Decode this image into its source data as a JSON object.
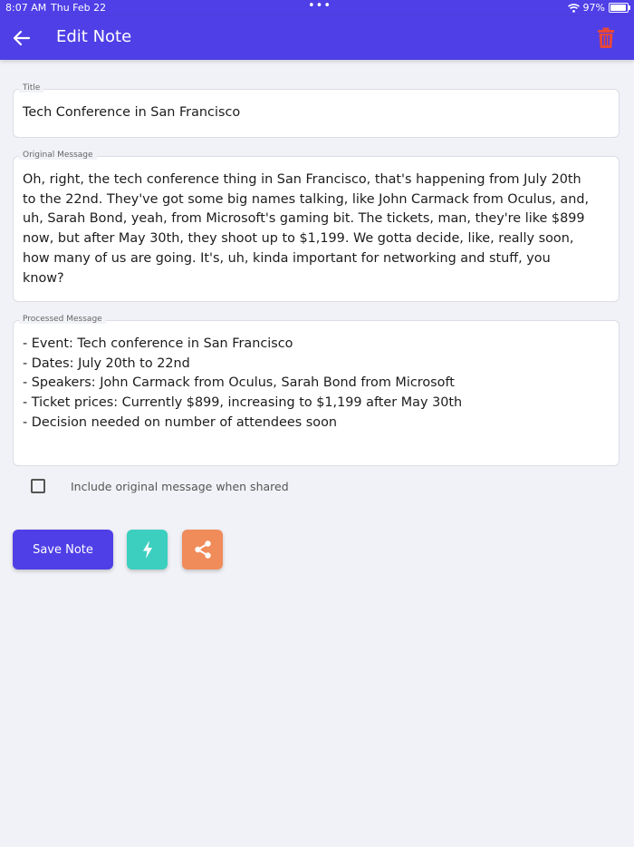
{
  "status_bar": {
    "time": "8:07 AM",
    "date": "Thu Feb 22",
    "battery_text": "97%",
    "battery_level": 0.97
  },
  "app_bar": {
    "title": "Edit Note",
    "back_icon": "arrow-left-icon",
    "delete_icon": "trash-icon",
    "delete_color": "#e8473a"
  },
  "form": {
    "title_label": "Title",
    "title_value": "Tech Conference in San Francisco",
    "original_label": "Original Message",
    "original_value": "Oh, right, the tech conference thing in San Francisco, that's happening from July 20th\nto the 22nd. They've got some big names talking, like John Carmack from Oculus, and,\nuh, Sarah Bond, yeah, from Microsoft's gaming bit. The tickets, man, they're like $899\nnow, but after May 30th, they shoot up to $1,199. We gotta decide, like, really soon,\nhow many of us are going. It's, uh, kinda important for networking and stuff, you\nknow?",
    "processed_label": "Processed Message",
    "processed_value": "- Event: Tech conference in San Francisco\n- Dates: July 20th to 22nd\n- Speakers: John Carmack from Oculus, Sarah Bond from Microsoft\n- Ticket prices: Currently $899, increasing to $1,199 after May 30th\n- Decision needed on number of attendees soon",
    "include_original_label": "Include original message when shared",
    "include_original_checked": false
  },
  "actions": {
    "save_label": "Save Note",
    "process_icon": "lightning-bolt-icon",
    "share_icon": "share-icon"
  },
  "colors": {
    "primary": "#4f3fe6",
    "process": "#3ccfbf",
    "share": "#f08b5a",
    "background": "#f1f2f7"
  }
}
